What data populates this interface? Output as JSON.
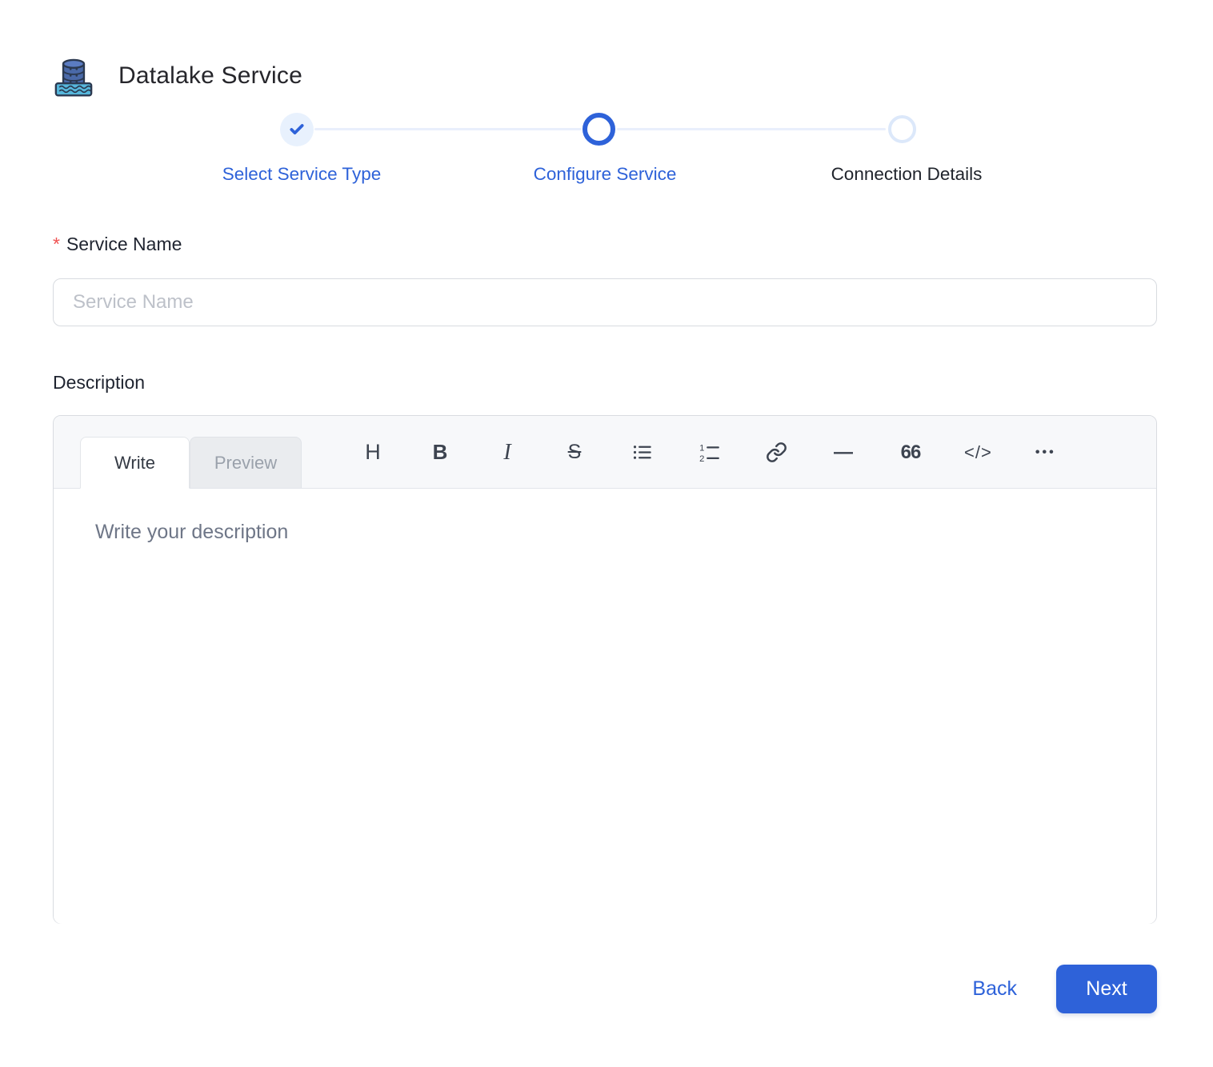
{
  "header": {
    "title": "Datalake Service"
  },
  "stepper": {
    "steps": [
      {
        "label": "Select Service Type",
        "state": "completed"
      },
      {
        "label": "Configure Service",
        "state": "active"
      },
      {
        "label": "Connection Details",
        "state": "pending"
      }
    ]
  },
  "form": {
    "required_marker": "*",
    "service_name": {
      "label": "Service Name",
      "placeholder": "Service Name",
      "value": ""
    },
    "description": {
      "label": "Description",
      "editor": {
        "tabs": [
          {
            "label": "Write",
            "active": true
          },
          {
            "label": "Preview",
            "active": false
          }
        ],
        "toolbar": [
          {
            "name": "heading",
            "glyph": "H"
          },
          {
            "name": "bold",
            "glyph": "B"
          },
          {
            "name": "italic",
            "glyph": "I"
          },
          {
            "name": "strikethrough",
            "glyph": "S"
          },
          {
            "name": "bulleted-list",
            "glyph": ""
          },
          {
            "name": "numbered-list",
            "glyph": ""
          },
          {
            "name": "link",
            "glyph": ""
          },
          {
            "name": "horizontal-rule",
            "glyph": "—"
          },
          {
            "name": "quote",
            "glyph": "66"
          },
          {
            "name": "code",
            "glyph": "</>"
          },
          {
            "name": "more",
            "glyph": "•••"
          }
        ],
        "placeholder": "Write your description",
        "value": ""
      }
    }
  },
  "footer": {
    "back_label": "Back",
    "next_label": "Next"
  },
  "colors": {
    "primary": "#2e62d9",
    "step_line": "#e9effc",
    "completed_bg": "#e8f1fd",
    "pending_ring": "#dce8fa",
    "border": "#d9dce1",
    "toolbar_bg": "#f7f8fa",
    "asterisk": "#f05252"
  }
}
